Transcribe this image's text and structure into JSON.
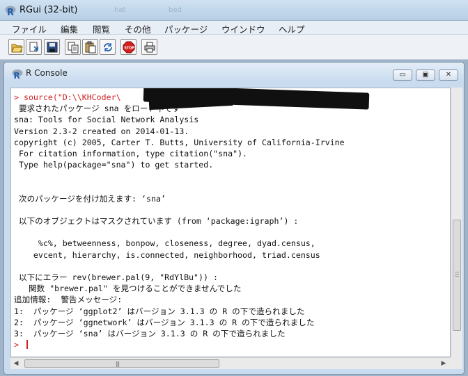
{
  "app": {
    "title": "RGui (32-bit)",
    "faded_tabs": [
      "hat",
      "bed"
    ]
  },
  "menu": {
    "items": [
      "ファイル",
      "編集",
      "閲覧",
      "その他",
      "パッケージ",
      "ウインドウ",
      "ヘルプ"
    ]
  },
  "toolbar": {
    "buttons": [
      "open-script-icon",
      "load-workspace-icon",
      "save-workspace-icon",
      "copy-icon",
      "paste-icon",
      "copy-paste-icon",
      "stop-icon",
      "print-icon"
    ]
  },
  "console": {
    "title": "R Console",
    "controls": {
      "minimize": "▭",
      "restore": "▣",
      "close": "✕"
    },
    "lines": [
      "> source(\"D:\\\\KHCoder\\                              <2$",
      " 要求されたパッケージ sna をロード中です",
      "sna: Tools for Social Network Analysis",
      "Version 2.3-2 created on 2014-01-13.",
      "copyright (c) 2005, Carter T. Butts, University of California-Irvine",
      " For citation information, type citation(\"sna\").",
      " Type help(package=\"sna\") to get started.",
      "",
      "",
      " 次のパッケージを付け加えます: ‘sna’",
      "",
      " 以下のオブジェクトはマスクされています (from ‘package:igraph’) :",
      "",
      "     %c%, betweenness, bonpow, closeness, degree, dyad.census,",
      "    evcent, hierarchy, is.connected, neighborhood, triad.census",
      "",
      " 以下にエラー rev(brewer.pal(9, \"RdYlBu\")) :",
      "   関数 \"brewer.pal\" を見つけることができませんでした",
      "追加情報:  警告メッセージ:",
      "1:  パッケージ ‘ggplot2’ はバージョン 3.1.3 の R の下で造られました",
      "2:  パッケージ ‘ggnetwork’ はバージョン 3.1.3 の R の下で造られました",
      "3:  パッケージ ‘sna’ はバージョン 3.1.3 の R の下で造られました",
      "> "
    ],
    "hscroll_grip": "|||"
  },
  "colors": {
    "command": "#d21f1f",
    "output": "#111111",
    "console_bg": "#ffffff"
  }
}
